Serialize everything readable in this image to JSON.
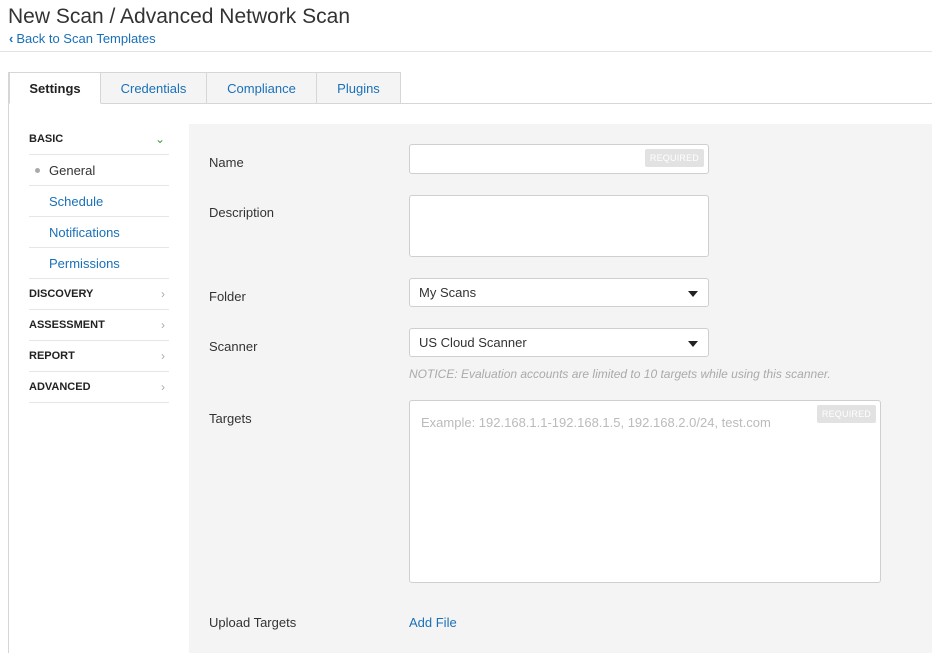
{
  "header": {
    "title": "New Scan / Advanced Network Scan",
    "back_link": "Back to Scan Templates"
  },
  "tabs": [
    {
      "label": "Settings",
      "active": true
    },
    {
      "label": "Credentials"
    },
    {
      "label": "Compliance"
    },
    {
      "label": "Plugins"
    }
  ],
  "sidebar": {
    "basic": "BASIC",
    "basic_items": [
      "General",
      "Schedule",
      "Notifications",
      "Permissions"
    ],
    "discovery": "DISCOVERY",
    "assessment": "ASSESSMENT",
    "report": "REPORT",
    "advanced": "ADVANCED"
  },
  "form": {
    "name_label": "Name",
    "name_value": "",
    "required_badge": "REQUIRED",
    "description_label": "Description",
    "description_value": "",
    "folder_label": "Folder",
    "folder_value": "My Scans",
    "scanner_label": "Scanner",
    "scanner_value": "US Cloud Scanner",
    "notice": "NOTICE: Evaluation accounts are limited to 10 targets while using this scanner.",
    "targets_label": "Targets",
    "targets_placeholder": "Example: 192.168.1.1-192.168.1.5, 192.168.2.0/24, test.com",
    "upload_label": "Upload Targets",
    "add_file": "Add File"
  },
  "colors": {
    "link": "#1a70b8",
    "panel_bg": "#f4f4f4",
    "open_chevron": "#3aa23a"
  }
}
